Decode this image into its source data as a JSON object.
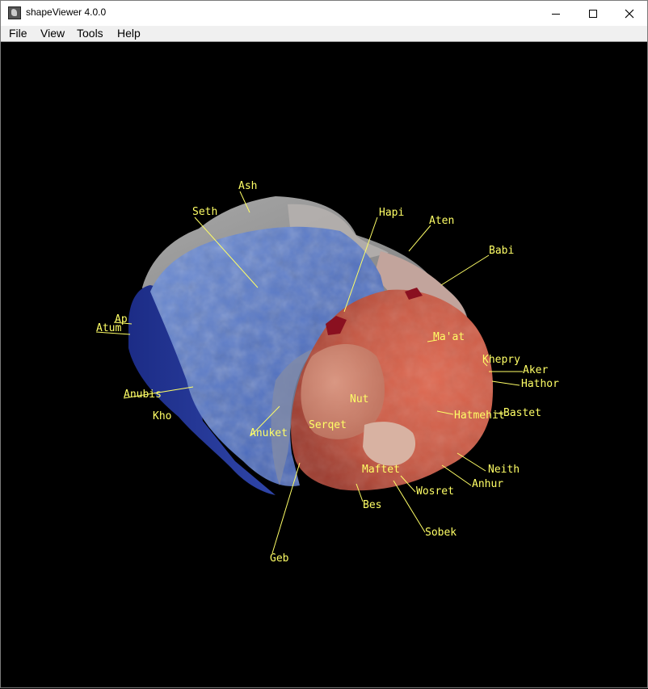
{
  "window": {
    "title": "shapeViewer 4.0.0",
    "icon": "comet-icon"
  },
  "menu": {
    "file": "File",
    "view": "View",
    "tools": "Tools",
    "help": "Help"
  },
  "regions": {
    "ash": "Ash",
    "seth": "Seth",
    "hapi": "Hapi",
    "aten": "Aten",
    "babi": "Babi",
    "apis": "Ap",
    "atum": "Atum",
    "maat": "Ma'at",
    "khepry": "Khepry",
    "aker": "Aker",
    "hathor": "Hathor",
    "anubis": "Anubis",
    "nut": "Nut",
    "bastet": "Bastet",
    "hatmehit": "Hatmehit",
    "khonsu": "Kho",
    "serqet": "Serqet",
    "anuket": "Anuket",
    "neith": "Neith",
    "maftet": "Maftet",
    "anhur": "Anhur",
    "wosret": "Wosret",
    "bes": "Bes",
    "sobek": "Sobek",
    "geb": "Geb"
  },
  "colors": {
    "label": "#ffff66",
    "background": "#000000"
  }
}
